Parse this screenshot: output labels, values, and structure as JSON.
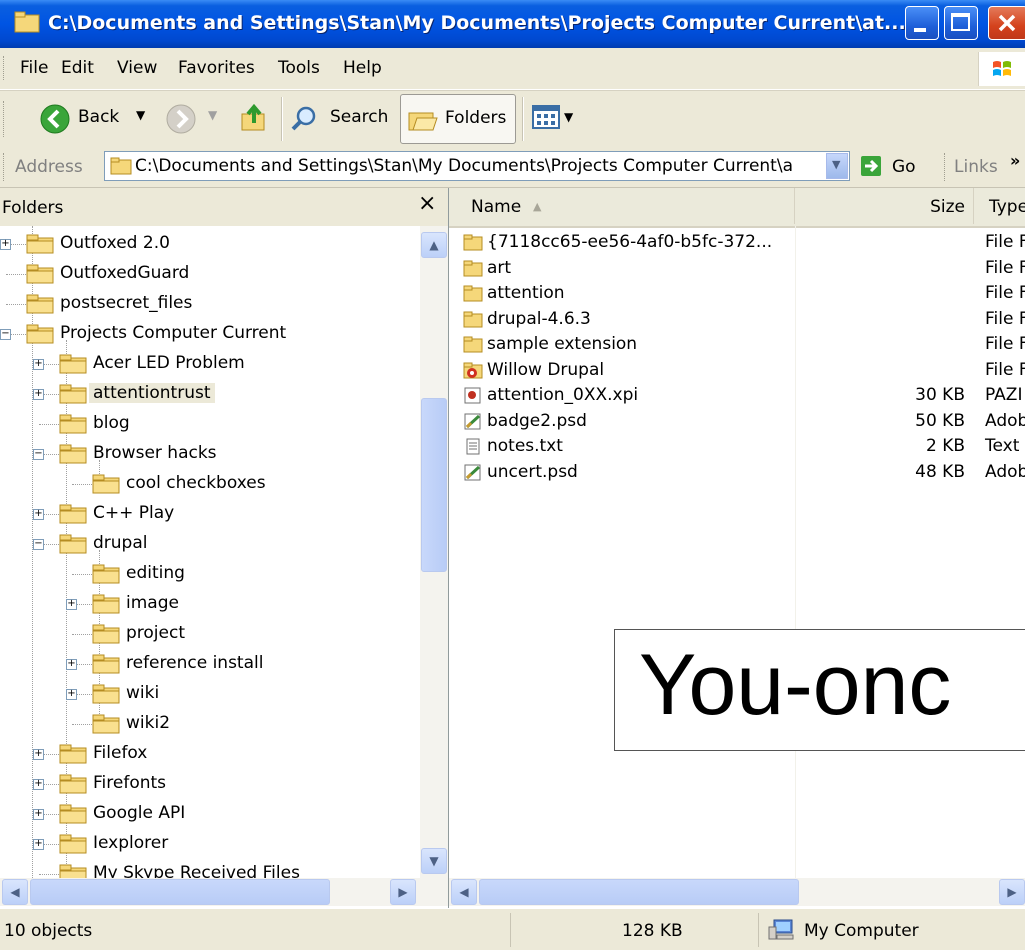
{
  "window": {
    "title": "C:\\Documents and Settings\\Stan\\My Documents\\Projects Computer Current\\at..."
  },
  "menu": [
    "File",
    "Edit",
    "View",
    "Favorites",
    "Tools",
    "Help"
  ],
  "toolbar": {
    "back_label": "Back",
    "search_label": "Search",
    "folders_label": "Folders"
  },
  "address": {
    "label": "Address",
    "value": "C:\\Documents and Settings\\Stan\\My Documents\\Projects Computer Current\\a",
    "go_label": "Go",
    "links_label": "Links",
    "chevron": "»"
  },
  "folders_pane": {
    "title": "Folders",
    "close_glyph": "×",
    "items": [
      {
        "label": "Outfoxed 2.0",
        "expander": "+"
      },
      {
        "label": "OutfoxedGuard",
        "expander": ""
      },
      {
        "label": "postsecret_files",
        "expander": ""
      },
      {
        "label": "Projects Computer Current",
        "expander": "−"
      },
      {
        "label": "Acer LED Problem",
        "expander": "+"
      },
      {
        "label": "attentiontrust",
        "expander": "+",
        "selected": true
      },
      {
        "label": "blog",
        "expander": ""
      },
      {
        "label": "Browser hacks",
        "expander": "−"
      },
      {
        "label": "cool checkboxes",
        "expander": ""
      },
      {
        "label": "C++ Play",
        "expander": "+"
      },
      {
        "label": "drupal",
        "expander": "−"
      },
      {
        "label": "editing",
        "expander": ""
      },
      {
        "label": "image",
        "expander": "+"
      },
      {
        "label": "project",
        "expander": ""
      },
      {
        "label": "reference install",
        "expander": "+"
      },
      {
        "label": "wiki",
        "expander": "+"
      },
      {
        "label": "wiki2",
        "expander": ""
      },
      {
        "label": "Filefox",
        "expander": "+"
      },
      {
        "label": "Firefonts",
        "expander": "+"
      },
      {
        "label": "Google API",
        "expander": "+"
      },
      {
        "label": "Iexplorer",
        "expander": "+"
      },
      {
        "label": "My Skype Received Files",
        "expander": ""
      }
    ]
  },
  "file_list": {
    "columns": {
      "name": "Name",
      "size": "Size",
      "type": "Type"
    },
    "files": [
      {
        "name": "{7118cc65-ee56-4af0-b5fc-372...",
        "size": "",
        "type": "File F",
        "icon": "folder-icon"
      },
      {
        "name": "art",
        "size": "",
        "type": "File F",
        "icon": "folder-icon"
      },
      {
        "name": "attention",
        "size": "",
        "type": "File F",
        "icon": "folder-icon"
      },
      {
        "name": "drupal-4.6.3",
        "size": "",
        "type": "File F",
        "icon": "folder-icon"
      },
      {
        "name": "sample extension",
        "size": "",
        "type": "File F",
        "icon": "folder-icon"
      },
      {
        "name": "Willow Drupal",
        "size": "",
        "type": "File F",
        "icon": "shared-folder-icon"
      },
      {
        "name": "attention_0XX.xpi",
        "size": "30 KB",
        "type": "PAZI",
        "icon": "xpi-file-icon"
      },
      {
        "name": "badge2.psd",
        "size": "50 KB",
        "type": "Adob",
        "icon": "psd-file-icon"
      },
      {
        "name": "notes.txt",
        "size": "2 KB",
        "type": "Text",
        "icon": "text-file-icon"
      },
      {
        "name": "uncert.psd",
        "size": "48 KB",
        "type": "Adob",
        "icon": "psd-file-icon"
      }
    ]
  },
  "status": {
    "objects": "10 objects",
    "size": "128 KB",
    "location": "My Computer"
  },
  "overlay": {
    "text": "You-onc"
  }
}
